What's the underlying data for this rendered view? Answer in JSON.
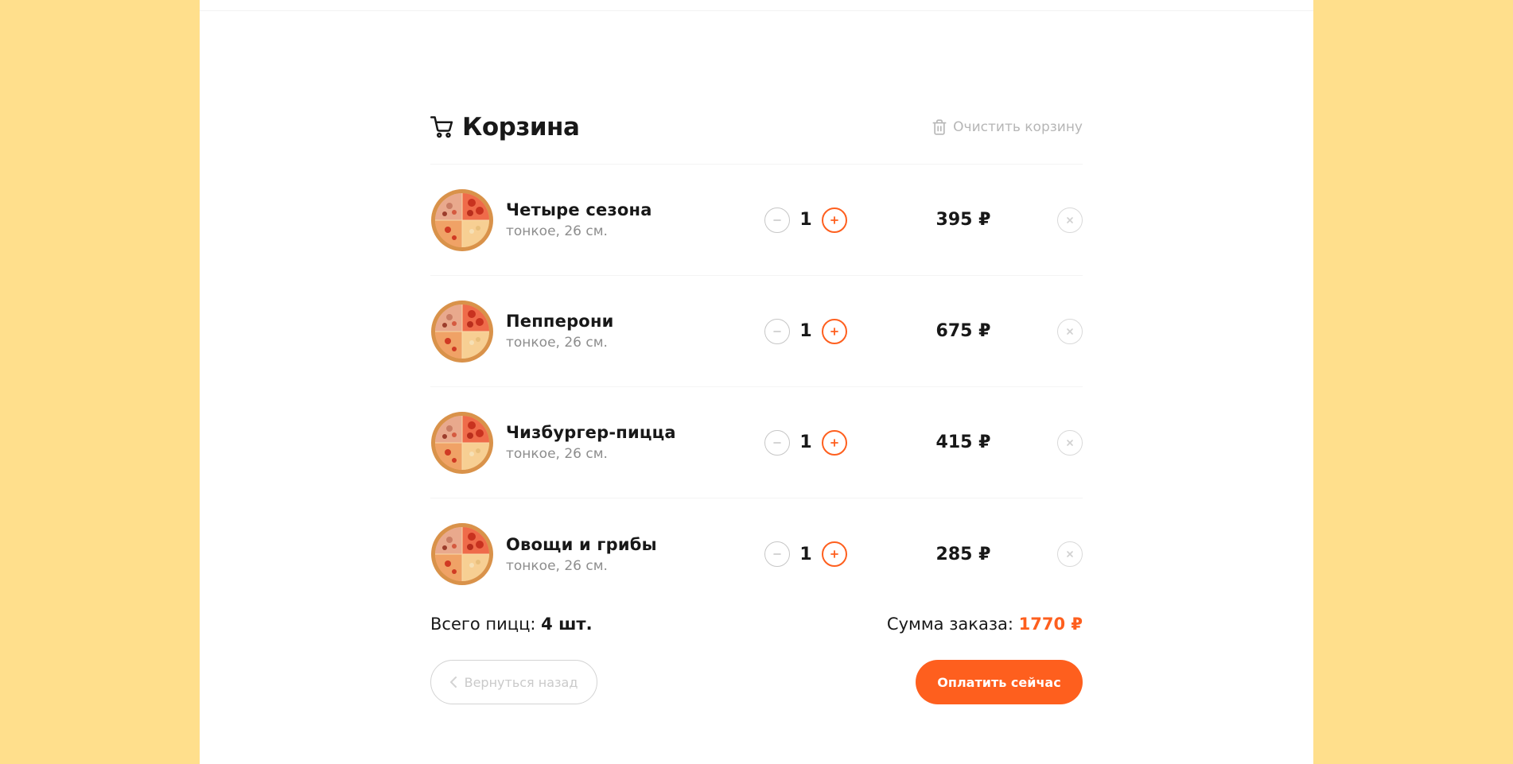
{
  "cart": {
    "title": "Корзина",
    "clear_label": "Очистить корзину",
    "currency": "₽",
    "items": [
      {
        "name": "Четыре сезона",
        "details": "тонкое, 26 см.",
        "count": "1",
        "price": "395 ₽"
      },
      {
        "name": "Пепперони",
        "details": "тонкое, 26 см.",
        "count": "1",
        "price": "675 ₽"
      },
      {
        "name": "Чизбургер-пицца",
        "details": "тонкое, 26 см.",
        "count": "1",
        "price": "415 ₽"
      },
      {
        "name": "Овощи и грибы",
        "details": "тонкое, 26 см.",
        "count": "1",
        "price": "285 ₽"
      }
    ],
    "total_count_label": "Всего пицц:",
    "total_count_value": "4 шт.",
    "total_sum_label": "Сумма заказа:",
    "total_sum_value": "1770 ₽",
    "back_label": "Вернуться назад",
    "pay_label": "Оплатить сейчас"
  },
  "colors": {
    "accent": "#fe5f1e",
    "page_background": "#FFDF8C",
    "card_background": "#ffffff",
    "muted_text": "#8d8d8d"
  },
  "icons": {
    "title": "cart-icon",
    "clear": "trash-icon",
    "minus": "minus-icon",
    "plus": "plus-icon",
    "remove": "close-icon",
    "back": "chevron-left-icon",
    "item_image": "pizza-image"
  }
}
